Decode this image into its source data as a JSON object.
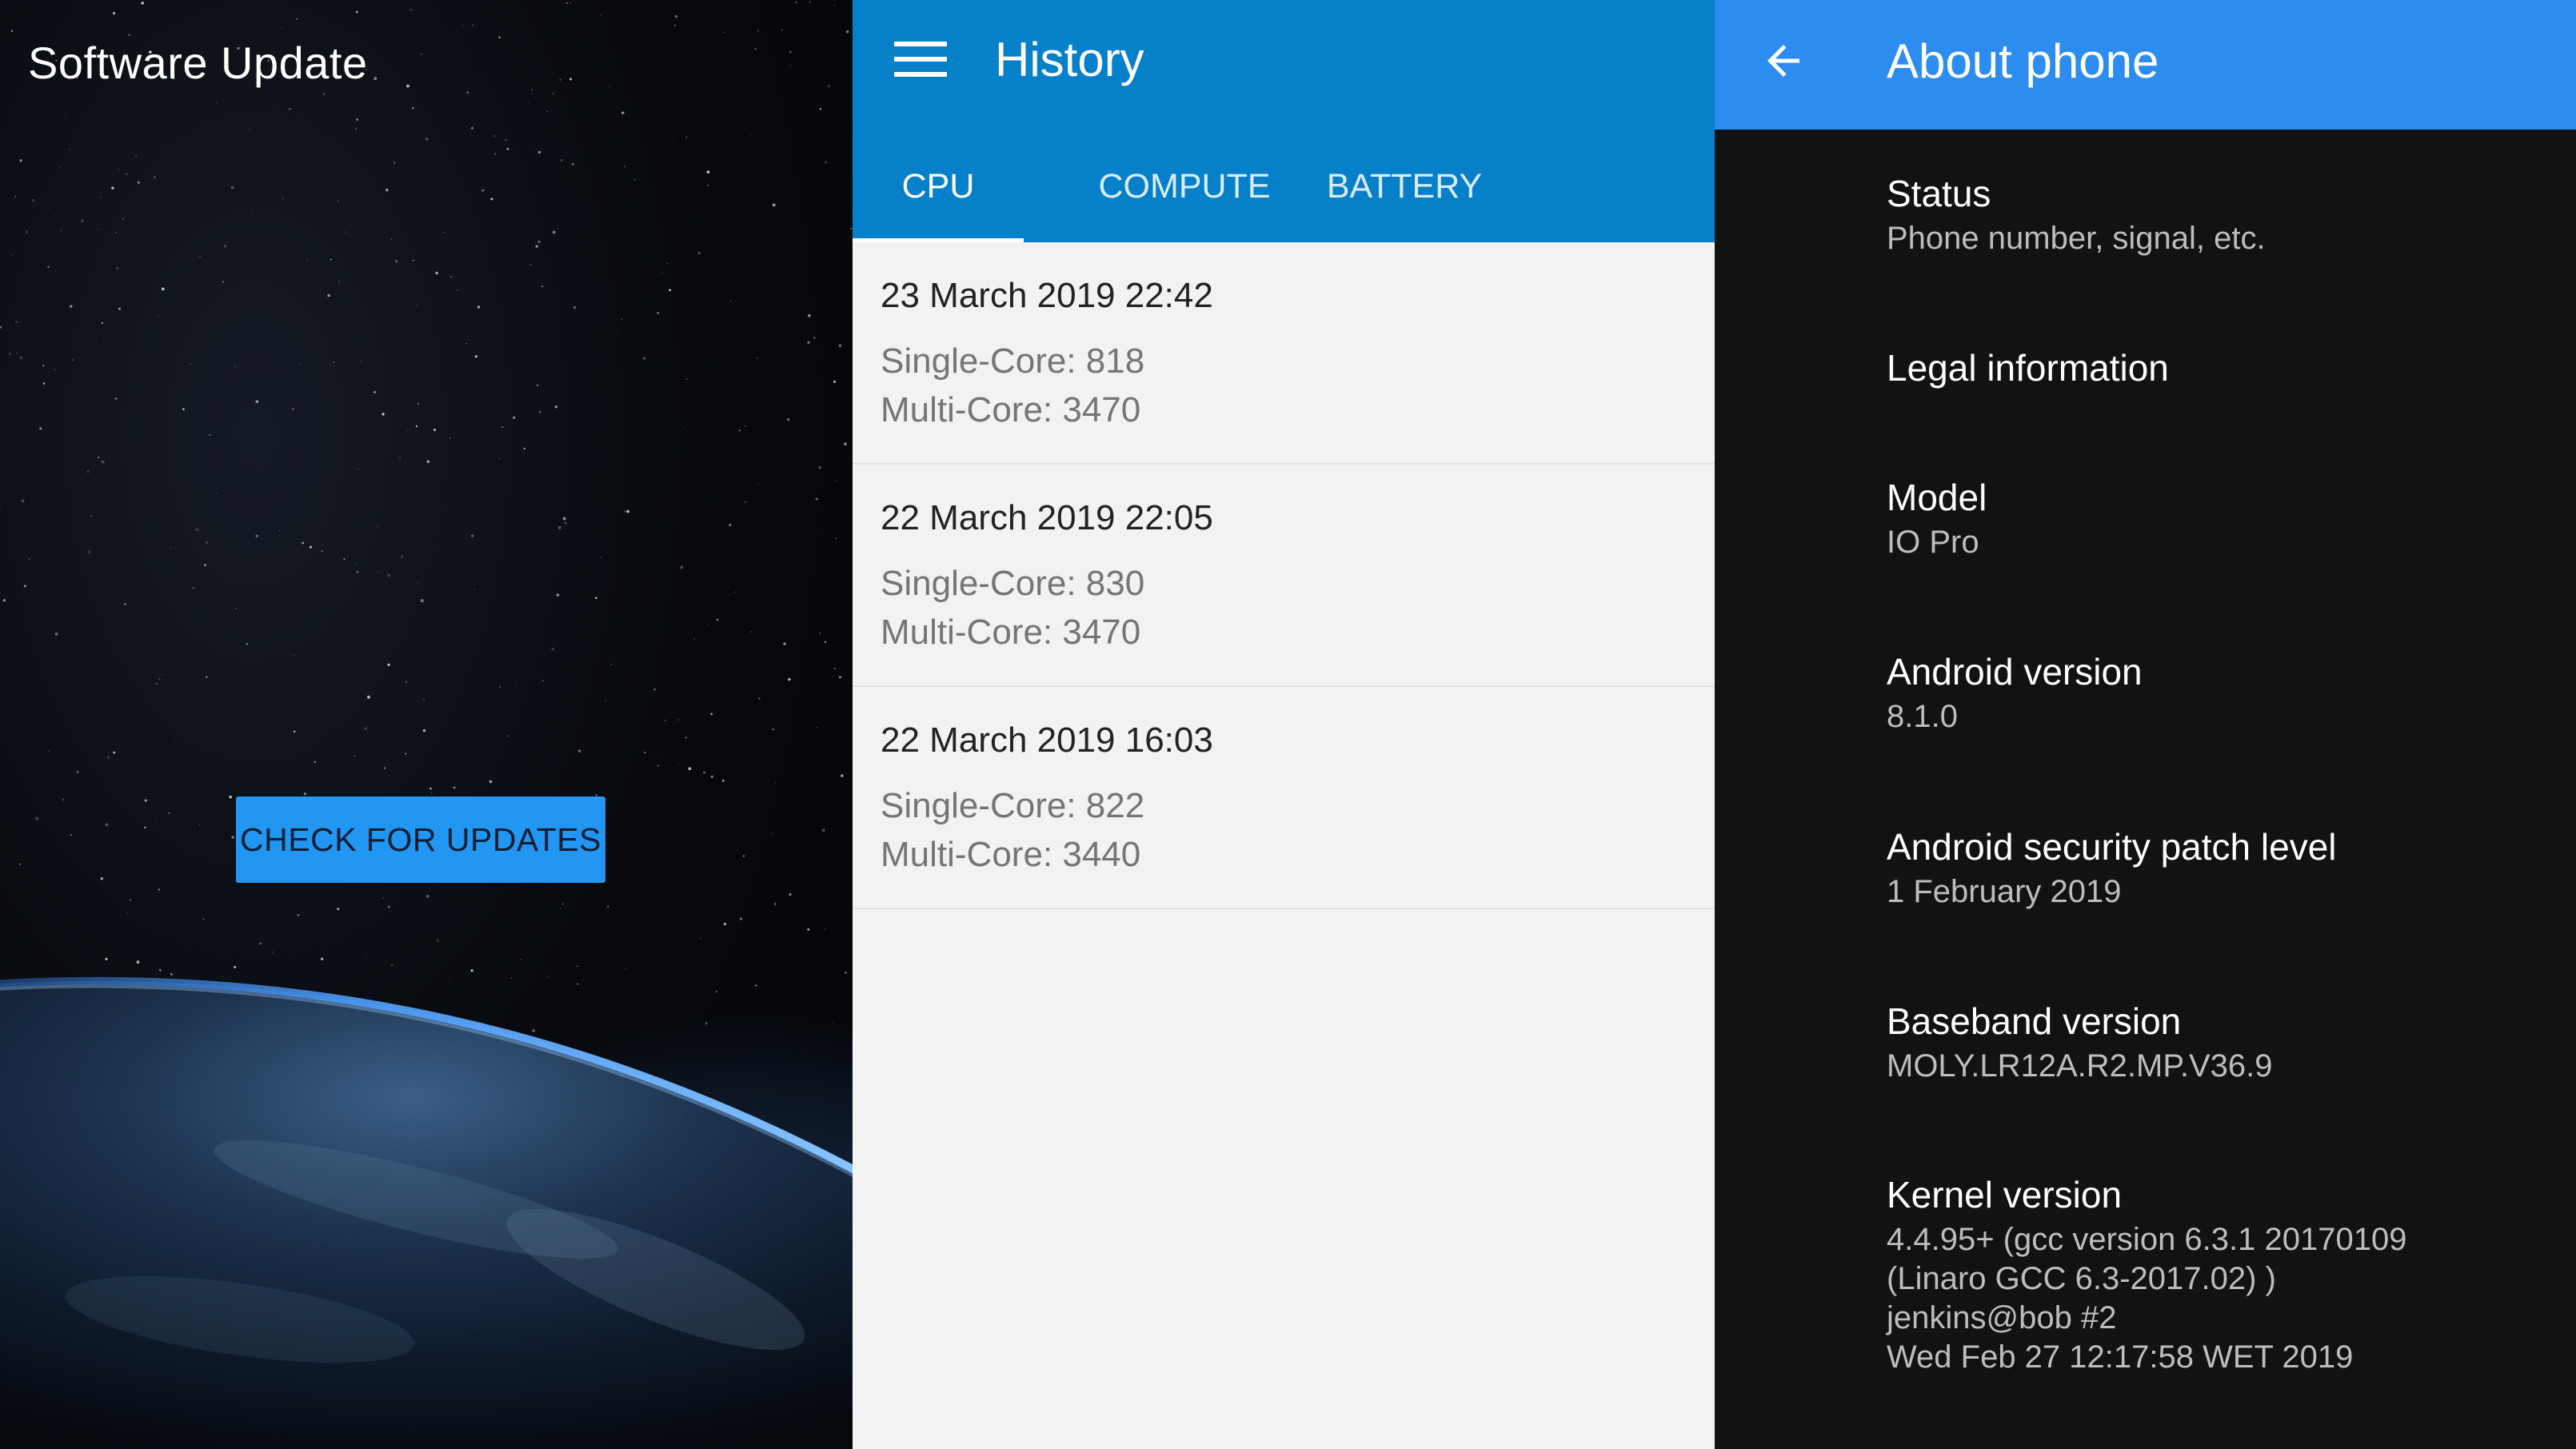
{
  "software_update": {
    "title": "Software Update",
    "check_button": "CHECK FOR UPDATES"
  },
  "history": {
    "title": "History",
    "tabs": [
      {
        "label": "CPU",
        "selected": true
      },
      {
        "label": "COMPUTE",
        "selected": false
      },
      {
        "label": "BATTERY",
        "selected": false
      }
    ],
    "items": [
      {
        "date": "23 March 2019 22:42",
        "single": "Single-Core: 818",
        "multi": "Multi-Core: 3470"
      },
      {
        "date": "22 March 2019 22:05",
        "single": "Single-Core: 830",
        "multi": "Multi-Core: 3470"
      },
      {
        "date": "22 March 2019 16:03",
        "single": "Single-Core: 822",
        "multi": "Multi-Core: 3440"
      }
    ]
  },
  "about": {
    "title": "About phone",
    "items": [
      {
        "title": "Status",
        "lines": [
          "Phone number, signal, etc."
        ]
      },
      {
        "title": "Legal information",
        "lines": []
      },
      {
        "title": "Model",
        "lines": [
          "IO Pro"
        ]
      },
      {
        "title": "Android version",
        "lines": [
          "8.1.0"
        ]
      },
      {
        "title": "Android security patch level",
        "lines": [
          "1 February 2019"
        ]
      },
      {
        "title": "Baseband version",
        "lines": [
          "MOLY.LR12A.R2.MP.V36.9"
        ]
      },
      {
        "title": "Kernel version",
        "lines": [
          "4.4.95+ (gcc version 6.3.1 20170109",
          "(Linaro GCC 6.3-2017.02) )",
          "jenkins@bob #2",
          "Wed Feb 27 12:17:58 WET 2019"
        ]
      }
    ]
  },
  "colors": {
    "history_appbar": "#0680c9",
    "about_appbar": "#2d8cef",
    "button": "#2196f3",
    "about_bg": "#121212",
    "history_bg": "#f2f2f2"
  },
  "icons": {
    "menu": "hamburger-menu-icon",
    "back": "arrow-left-icon"
  }
}
